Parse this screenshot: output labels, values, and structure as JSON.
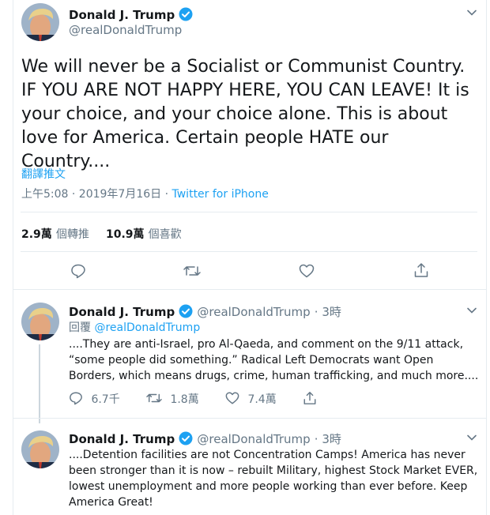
{
  "main_tweet": {
    "author_name": "Donald J. Trump",
    "author_handle": "@realDonaldTrump",
    "text": "We will never be a Socialist or Communist Country. IF YOU ARE NOT HAPPY HERE, YOU CAN LEAVE! It is your choice, and your choice alone. This is about love for America. Certain people HATE our Country....",
    "translate_label": "翻譯推文",
    "time": "上午5:08 · 2019年7月16日",
    "dot": "·",
    "source": "Twitter for iPhone",
    "retweets_count": "2.9萬",
    "retweets_label": "個轉推",
    "likes_count": "10.9萬",
    "likes_label": "個喜歡"
  },
  "replies": [
    {
      "author_name": "Donald J. Trump",
      "author_handle": "@realDonaldTrump",
      "time": "· 3時",
      "reply_to_label": "回覆",
      "reply_to_handle": "@realDonaldTrump",
      "text": "....They are anti-Israel, pro Al-Qaeda, and comment on the 9/11 attack, “some people did something.” Radical Left Democrats want Open Borders, which means drugs, crime, human trafficking, and much more....",
      "reply_count": "6.7千",
      "retweet_count": "1.8萬",
      "like_count": "7.4萬"
    },
    {
      "author_name": "Donald J. Trump",
      "author_handle": "@realDonaldTrump",
      "time": "· 3時",
      "text": "....Detention facilities are not Concentration Camps! America has never been stronger than it is now – rebuilt Military, highest Stock Market EVER, lowest unemployment and more people working than ever before. Keep America Great!"
    }
  ],
  "colors": {
    "accent": "#1da1f2",
    "text": "#14171a",
    "secondary": "#657786",
    "divider": "#e6ecf0"
  },
  "icons": [
    "verified-icon",
    "chevron-down-icon",
    "reply-icon",
    "retweet-icon",
    "like-icon",
    "share-icon"
  ]
}
